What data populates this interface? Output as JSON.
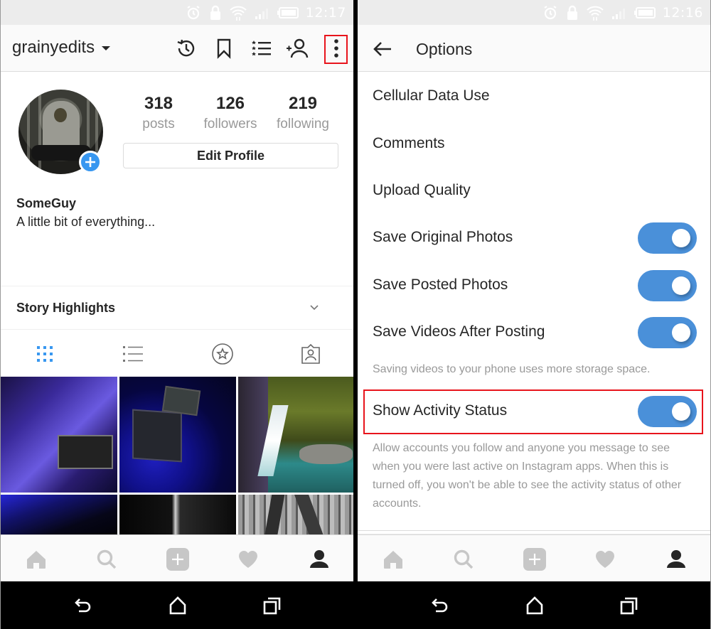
{
  "left_screen": {
    "status_bar": {
      "time": "12:17",
      "icons": [
        "alarm-icon",
        "lock-icon",
        "wifi-icon",
        "signal-icon",
        "battery-icon"
      ]
    },
    "header": {
      "username": "grainyedits",
      "actions": [
        "archive-icon",
        "saved-icon",
        "close-friends-icon",
        "discover-people-icon",
        "more-options-icon"
      ],
      "highlighted_action": "more-options-icon"
    },
    "profile": {
      "stats": [
        {
          "value": "318",
          "label": "posts"
        },
        {
          "value": "126",
          "label": "followers"
        },
        {
          "value": "219",
          "label": "following"
        }
      ],
      "edit_button": "Edit Profile",
      "full_name": "SomeGuy",
      "bio": "A little bit of everything..."
    },
    "story_highlights": {
      "title": "Story Highlights"
    },
    "view_tabs": [
      {
        "name": "grid-view",
        "active": true
      },
      {
        "name": "list-view",
        "active": false
      },
      {
        "name": "saved-collection",
        "active": false
      },
      {
        "name": "tagged-photos",
        "active": false
      }
    ],
    "photos": [
      "purple pc setup",
      "blue desk monitors",
      "waterfall",
      "blue room",
      "dark hallway",
      "bare forest"
    ],
    "bottom_tabs": [
      "home",
      "search",
      "new-post",
      "activity",
      "profile"
    ],
    "active_bottom_tab": "profile"
  },
  "right_screen": {
    "status_bar": {
      "time": "12:16"
    },
    "header": {
      "title": "Options"
    },
    "options": [
      {
        "label": "Cellular Data Use",
        "toggle": null
      },
      {
        "label": "Comments",
        "toggle": null
      },
      {
        "label": "Upload Quality",
        "toggle": null
      },
      {
        "label": "Save Original Photos",
        "toggle": true
      },
      {
        "label": "Save Posted Photos",
        "toggle": true
      },
      {
        "label": "Save Videos After Posting",
        "toggle": true
      }
    ],
    "save_videos_note": "Saving videos to your phone uses more storage space.",
    "activity_status": {
      "label": "Show Activity Status",
      "toggle": true,
      "description": "Allow accounts you follow and anyone you message to see when you were last active on Instagram apps. When this is turned off, you won't be able to see the activity status of other accounts."
    }
  },
  "colors": {
    "accent_blue": "#3897f0",
    "toggle_on": "#4a90d9",
    "highlight_red": "#e8141c",
    "text_primary": "#262626",
    "text_secondary": "#999999"
  }
}
